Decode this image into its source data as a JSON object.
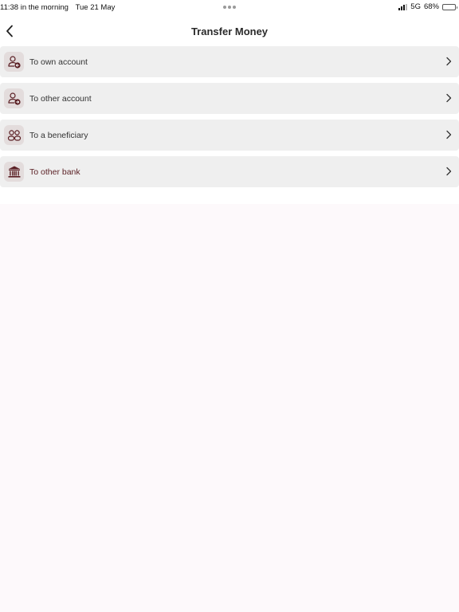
{
  "status_bar": {
    "time": "11:38 in the morning",
    "date": "Tue 21 May",
    "network": "5G",
    "battery": "68%",
    "battery_level": 0.68
  },
  "header": {
    "title": "Transfer Money",
    "back_icon": "chevron-left-icon"
  },
  "options": [
    {
      "label": "To own account",
      "icon": "user-arrow-in-icon"
    },
    {
      "label": "To other account",
      "icon": "user-arrow-out-icon"
    },
    {
      "label": "To a beneficiary",
      "icon": "users-icon"
    },
    {
      "label": "To other bank",
      "icon": "bank-icon"
    }
  ],
  "colors": {
    "accent": "#5a1f24",
    "row_background": "#efefef",
    "icon_background": "#e3dcdc",
    "content_background": "#fdf9fb"
  }
}
